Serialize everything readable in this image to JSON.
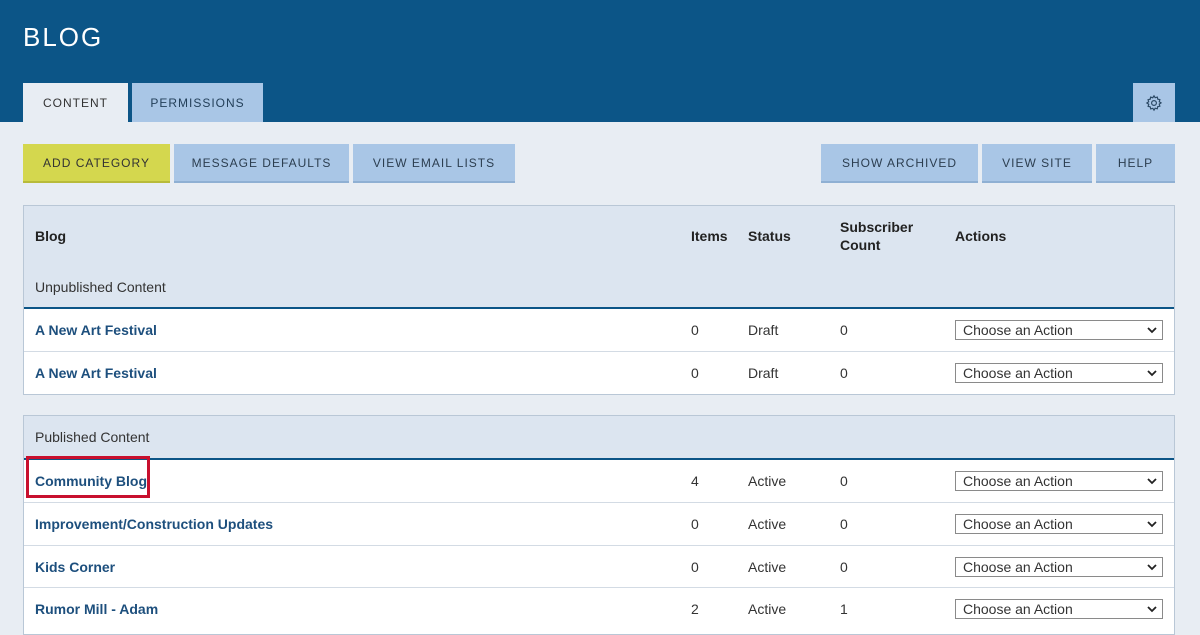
{
  "header": {
    "title": "BLOG",
    "tabs": [
      {
        "label": "CONTENT",
        "active": true
      },
      {
        "label": "PERMISSIONS",
        "active": false
      }
    ],
    "settings_icon": "gear-icon"
  },
  "toolbar": {
    "add_category": "ADD CATEGORY",
    "message_defaults": "MESSAGE DEFAULTS",
    "view_email_lists": "VIEW EMAIL LISTS",
    "show_archived": "SHOW ARCHIVED",
    "view_site": "VIEW SITE",
    "help": "HELP"
  },
  "table": {
    "columns": {
      "blog": "Blog",
      "items": "Items",
      "status": "Status",
      "subscriber_line1": "Subscriber",
      "subscriber_line2": "Count",
      "actions": "Actions"
    },
    "action_placeholder": "Choose an Action",
    "unpublished": {
      "label": "Unpublished Content",
      "rows": [
        {
          "name": "A New Art Festival",
          "items": "0",
          "status": "Draft",
          "subscribers": "0"
        },
        {
          "name": "A New Art Festival",
          "items": "0",
          "status": "Draft",
          "subscribers": "0"
        }
      ]
    },
    "published": {
      "label": "Published Content",
      "rows": [
        {
          "name": "Community Blog",
          "items": "4",
          "status": "Active",
          "subscribers": "0"
        },
        {
          "name": "Improvement/Construction Updates",
          "items": "0",
          "status": "Active",
          "subscribers": "0"
        },
        {
          "name": "Kids Corner",
          "items": "0",
          "status": "Active",
          "subscribers": "0"
        },
        {
          "name": "Rumor Mill - Adam",
          "items": "2",
          "status": "Active",
          "subscribers": "1"
        }
      ]
    }
  },
  "colors": {
    "header_bg": "#0c5587",
    "tab_inactive": "#a9c6e6",
    "add_button": "#d4d74e",
    "link": "#1d4f7d",
    "highlight": "#c8102e"
  }
}
